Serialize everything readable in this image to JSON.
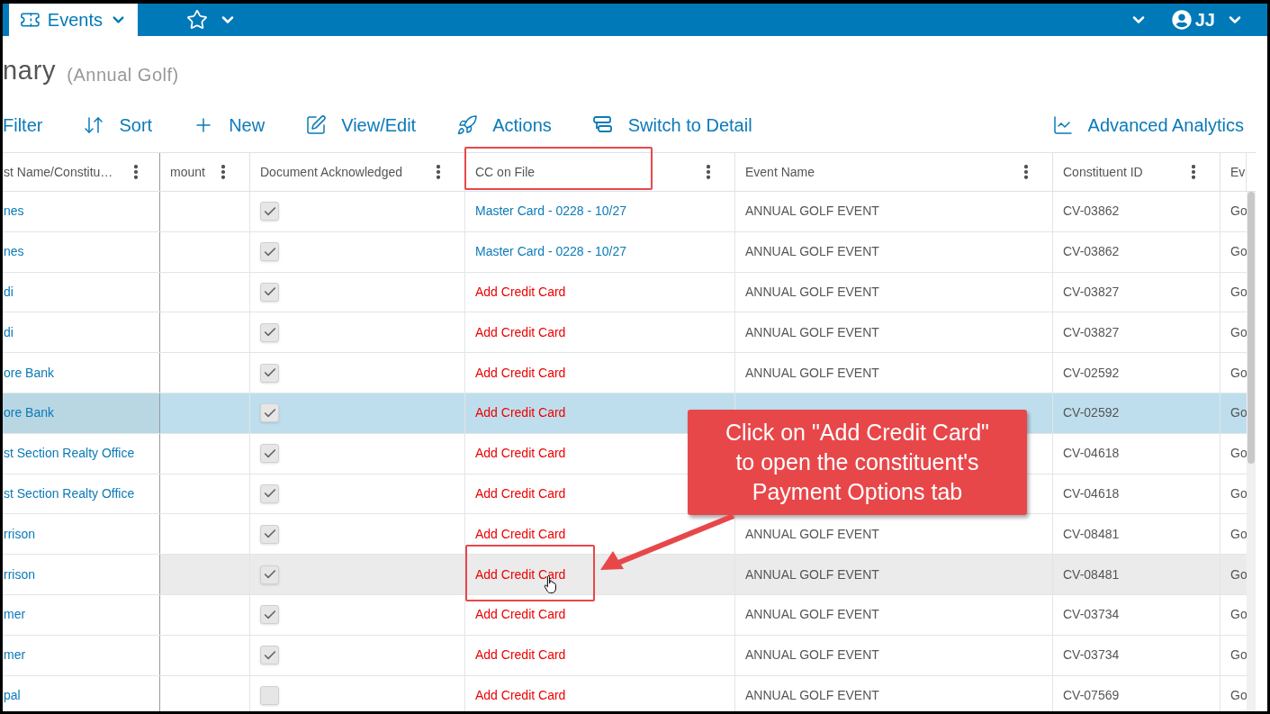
{
  "top_bar": {
    "module_tab": {
      "label": "Events",
      "selected": true
    },
    "user": {
      "initials": "JJ"
    }
  },
  "page": {
    "title": "nary",
    "subtitle": "(Annual Golf)"
  },
  "toolbar": {
    "left": [
      {
        "kind": "filter",
        "label": "Filter"
      },
      {
        "kind": "sort",
        "label": "Sort"
      },
      {
        "kind": "new",
        "label": "New"
      },
      {
        "kind": "edit",
        "label": "View/Edit"
      },
      {
        "kind": "actions",
        "label": "Actions"
      },
      {
        "kind": "switch",
        "label": "Switch to Detail"
      }
    ],
    "right": [
      {
        "kind": "analytics",
        "label": "Advanced Analytics"
      }
    ]
  },
  "table": {
    "columns": [
      {
        "label": "st Name/Constitu…",
        "menu": true
      },
      {
        "label": "mount",
        "menu": true
      },
      {
        "label": "Document Acknowledged",
        "menu": true
      },
      {
        "label": "CC on File",
        "menu": true
      },
      {
        "label": "Event Name",
        "menu": true
      },
      {
        "label": "Constituent ID",
        "menu": true
      },
      {
        "label": "Ev",
        "menu": false
      }
    ],
    "rows": [
      {
        "name": "nes",
        "checked": true,
        "cc": {
          "text": "Master Card - 0228 - 10/27",
          "kind": "card"
        },
        "event": "ANNUAL GOLF EVENT",
        "id": "CV-03862",
        "ev": "Go",
        "selected": false,
        "hovered": false
      },
      {
        "name": "nes",
        "checked": true,
        "cc": {
          "text": "Master Card - 0228 - 10/27",
          "kind": "card"
        },
        "event": "ANNUAL GOLF EVENT",
        "id": "CV-03862",
        "ev": "Go",
        "selected": false,
        "hovered": false
      },
      {
        "name": "di",
        "checked": true,
        "cc": {
          "text": "Add Credit Card",
          "kind": "add"
        },
        "event": "ANNUAL GOLF EVENT",
        "id": "CV-03827",
        "ev": "Go",
        "selected": false,
        "hovered": false
      },
      {
        "name": "di",
        "checked": true,
        "cc": {
          "text": "Add Credit Card",
          "kind": "add"
        },
        "event": "ANNUAL GOLF EVENT",
        "id": "CV-03827",
        "ev": "Go",
        "selected": false,
        "hovered": false
      },
      {
        "name": "ore Bank",
        "checked": true,
        "cc": {
          "text": "Add Credit Card",
          "kind": "add"
        },
        "event": "ANNUAL GOLF EVENT",
        "id": "CV-02592",
        "ev": "Go",
        "selected": false,
        "hovered": false
      },
      {
        "name": "ore Bank",
        "checked": true,
        "cc": {
          "text": "Add Credit Card",
          "kind": "add"
        },
        "id": "CV-02592",
        "ev": "Go",
        "selected": true,
        "hovered": false
      },
      {
        "name": "st Section Realty Office",
        "checked": true,
        "cc": {
          "text": "Add Credit Card",
          "kind": "add"
        },
        "id": "CV-04618",
        "ev": "Go",
        "selected": false,
        "hovered": false
      },
      {
        "name": "st Section Realty Office",
        "checked": true,
        "cc": {
          "text": "Add Credit Card",
          "kind": "add"
        },
        "id": "CV-04618",
        "ev": "Go",
        "selected": false,
        "hovered": false
      },
      {
        "name": "rrison",
        "checked": true,
        "cc": {
          "text": "Add Credit Card",
          "kind": "add"
        },
        "event": "ANNUAL GOLF EVENT",
        "id": "CV-08481",
        "ev": "Go",
        "selected": false,
        "hovered": false
      },
      {
        "name": "rrison",
        "checked": true,
        "cc": {
          "text": "Add Credit Card",
          "kind": "add"
        },
        "event": "ANNUAL GOLF EVENT",
        "id": "CV-08481",
        "ev": "Go",
        "selected": false,
        "hovered": true
      },
      {
        "name": "mer",
        "checked": true,
        "cc": {
          "text": "Add Credit Card",
          "kind": "add"
        },
        "event": "ANNUAL GOLF EVENT",
        "id": "CV-03734",
        "ev": "Go",
        "selected": false,
        "hovered": false
      },
      {
        "name": "mer",
        "checked": true,
        "cc": {
          "text": "Add Credit Card",
          "kind": "add"
        },
        "event": "ANNUAL GOLF EVENT",
        "id": "CV-03734",
        "ev": "Go",
        "selected": false,
        "hovered": false
      },
      {
        "name": "pal",
        "checked": false,
        "cc": {
          "text": "Add Credit Card",
          "kind": "add"
        },
        "event": "ANNUAL GOLF EVENT",
        "id": "CV-07569",
        "ev": "Go",
        "selected": false,
        "hovered": false
      }
    ]
  },
  "annotation": {
    "lines": [
      "Click on \"Add Credit Card\"",
      "to open the constituent's",
      "Payment Options tab"
    ]
  }
}
